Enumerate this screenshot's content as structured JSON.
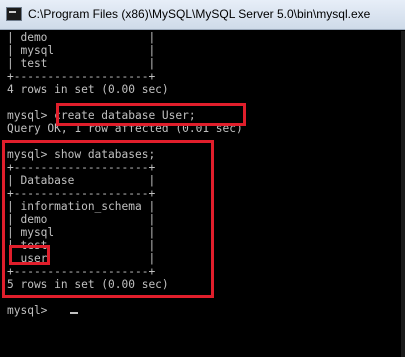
{
  "window": {
    "title": "C:\\Program Files (x86)\\MySQL\\MySQL Server 5.0\\bin\\mysql.exe"
  },
  "console": {
    "lines": [
      "| demo               |",
      "| mysql              |",
      "| test               |",
      "+--------------------+",
      "4 rows in set (0.00 sec)",
      "",
      "mysql> create database User;",
      "Query OK, 1 row affected (0.01 sec)",
      "",
      "mysql> show databases;",
      "+--------------------+",
      "| Database           |",
      "+--------------------+",
      "| information_schema |",
      "| demo               |",
      "| mysql              |",
      "| test               |",
      "| user               |",
      "+--------------------+",
      "5 rows in set (0.00 sec)",
      "",
      "mysql> "
    ]
  },
  "highlight_color": "#e01e2b"
}
